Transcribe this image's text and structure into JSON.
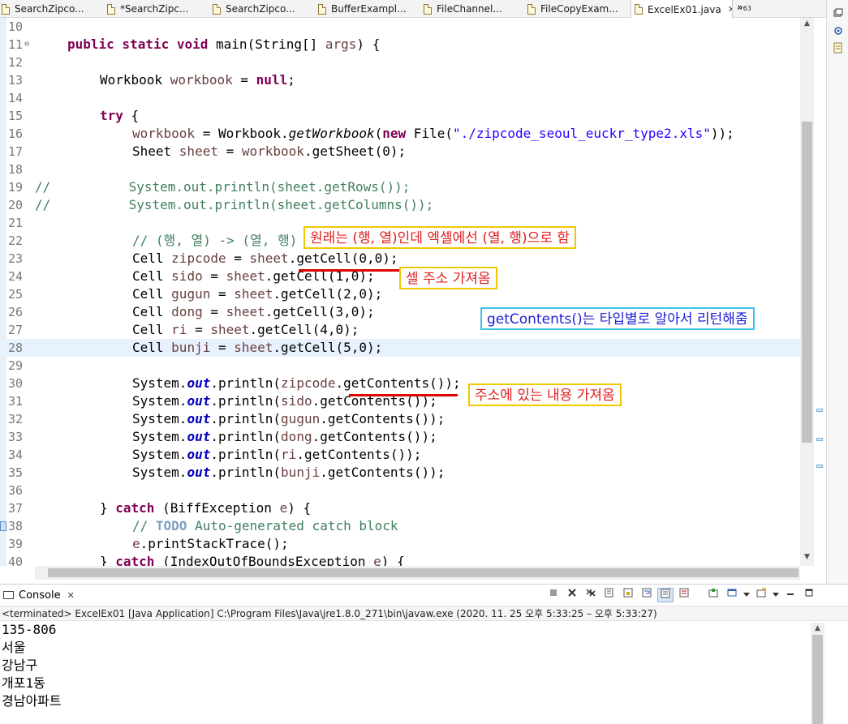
{
  "tabs": [
    {
      "label": "SearchZipco..."
    },
    {
      "label": "*SearchZipc..."
    },
    {
      "label": "SearchZipco..."
    },
    {
      "label": "BufferExampl..."
    },
    {
      "label": "FileChannel..."
    },
    {
      "label": "FileCopyExam..."
    },
    {
      "label": "ExcelEx01.java"
    }
  ],
  "overflow": {
    "chevrons": "»",
    "count": "63"
  },
  "icons": {
    "close": "✕",
    "scroll_up": "▲",
    "scroll_down": "▼"
  },
  "editor": {
    "lines": [
      {
        "n": "10"
      },
      {
        "n": "11"
      },
      {
        "n": "12"
      },
      {
        "n": "13"
      },
      {
        "n": "14"
      },
      {
        "n": "15"
      },
      {
        "n": "16"
      },
      {
        "n": "17"
      },
      {
        "n": "18"
      },
      {
        "n": "19"
      },
      {
        "n": "20"
      },
      {
        "n": "21"
      },
      {
        "n": "22"
      },
      {
        "n": "23"
      },
      {
        "n": "24"
      },
      {
        "n": "25"
      },
      {
        "n": "26"
      },
      {
        "n": "27"
      },
      {
        "n": "28"
      },
      {
        "n": "29"
      },
      {
        "n": "30"
      },
      {
        "n": "31"
      },
      {
        "n": "32"
      },
      {
        "n": "33"
      },
      {
        "n": "34"
      },
      {
        "n": "35"
      },
      {
        "n": "36"
      },
      {
        "n": "37"
      },
      {
        "n": "38"
      },
      {
        "n": "39"
      },
      {
        "n": "40"
      }
    ],
    "code": {
      "l11_a": "public static void ",
      "l11_b": "main(String[] ",
      "l11_c": "args",
      "l11_d": ") {",
      "l13_a": "Workbook ",
      "l13_b": "workbook",
      "l13_c": " = ",
      "l13_d": "null",
      "l13_e": ";",
      "l15_a": "try",
      "l15_b": " {",
      "l16_a": "workbook",
      "l16_b": " = Workbook.",
      "l16_c": "getWorkbook",
      "l16_d": "(",
      "l16_e": "new",
      "l16_f": " File(",
      "l16_g": "\"./zipcode_seoul_euckr_type2.xls\"",
      "l16_h": "));",
      "l17_a": "Sheet ",
      "l17_b": "sheet",
      "l17_c": " = ",
      "l17_d": "workbook",
      "l17_e": ".getSheet(0);",
      "l19": "//          System.out.println(sheet.getRows());",
      "l20": "//          System.out.println(sheet.getColumns());",
      "l22": "// (행, 열) -> (열, 행)",
      "cells": [
        {
          "name": "zipcode",
          "pre": "Cell ",
          "mid": " = ",
          "obj": "sheet",
          "call": ".getCell(0,0);"
        },
        {
          "name": "sido",
          "pre": "Cell ",
          "mid": " = ",
          "obj": "sheet",
          "call": ".getCell(1,0);"
        },
        {
          "name": "gugun",
          "pre": "Cell ",
          "mid": " = ",
          "obj": "sheet",
          "call": ".getCell(2,0);"
        },
        {
          "name": "dong",
          "pre": "Cell ",
          "mid": " = ",
          "obj": "sheet",
          "call": ".getCell(3,0);"
        },
        {
          "name": "ri",
          "pre": "Cell ",
          "mid": " = ",
          "obj": "sheet",
          "call": ".getCell(4,0);"
        },
        {
          "name": "bunji",
          "pre": "Cell ",
          "mid": " = ",
          "obj": "sheet",
          "call": ".getCell(5,0);"
        }
      ],
      "prints": [
        {
          "sys": "System.",
          "out": "out",
          "pln": ".println(",
          "v": "zipcode",
          "rest": ".getContents());"
        },
        {
          "sys": "System.",
          "out": "out",
          "pln": ".println(",
          "v": "sido",
          "rest": ".getContents());"
        },
        {
          "sys": "System.",
          "out": "out",
          "pln": ".println(",
          "v": "gugun",
          "rest": ".getContents());"
        },
        {
          "sys": "System.",
          "out": "out",
          "pln": ".println(",
          "v": "dong",
          "rest": ".getContents());"
        },
        {
          "sys": "System.",
          "out": "out",
          "pln": ".println(",
          "v": "ri",
          "rest": ".getContents());"
        },
        {
          "sys": "System.",
          "out": "out",
          "pln": ".println(",
          "v": "bunji",
          "rest": ".getContents());"
        }
      ],
      "l37_a": "} ",
      "l37_b": "catch",
      "l37_c": " (BiffException ",
      "l37_d": "e",
      "l37_e": ") {",
      "l38_a": "// ",
      "l38_b": "TODO",
      "l38_c": " Auto-generated catch block",
      "l39_a": "e",
      "l39_b": ".printStackTrace();",
      "l40_a": "} ",
      "l40_b": "catch",
      "l40_c": " (IndexOutOfBoundsException ",
      "l40_d": "e",
      "l40_e": ") {"
    }
  },
  "annotations": {
    "note1": "원래는 (행, 열)인데 엑셀에선 (열, 행)으로 함",
    "note2": "셀 주소 가져옴",
    "note3": "getContents()는 타입별로 알아서 리턴해줌",
    "note4": "주소에 있는 내용 가져옴"
  },
  "console": {
    "tab_label": "Console",
    "status": "<terminated> ExcelEx01 [Java Application] C:\\Program Files\\Java\\jre1.8.0_271\\bin\\javaw.exe  (2020. 11. 25 오후 5:33:25 – 오후 5:33:27)",
    "output": [
      "135-806",
      "서울",
      "강남구",
      "개포1동",
      "경남아파트"
    ]
  },
  "colors": {
    "keyword": "#7f0055",
    "comment": "#3f7f5f",
    "string": "#2a00ff",
    "static_field": "#0000c0",
    "local_var": "#6a3e3e",
    "current_line": "#e8f2fe",
    "annotation_border": "#f0c800",
    "annotation_text": "#e02020",
    "annotation_border_alt": "#3fc4e6",
    "annotation_text_alt": "#2020d8"
  }
}
